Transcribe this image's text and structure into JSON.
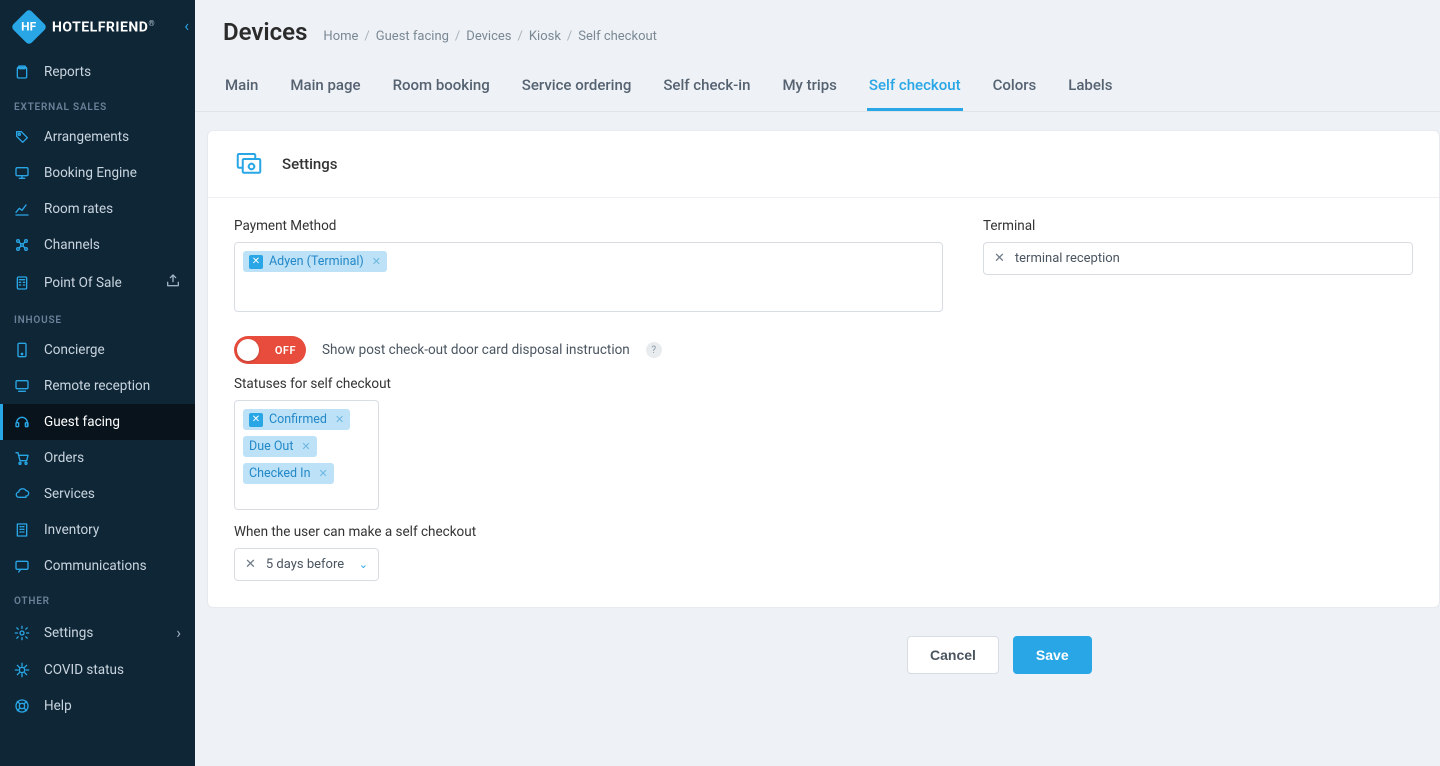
{
  "brand": {
    "name": "HOTELFRIEND",
    "logo_text": "HF"
  },
  "sidebar": {
    "top": [
      {
        "icon": "clipboard",
        "label": "Reports"
      }
    ],
    "sections": [
      {
        "title": "EXTERNAL SALES",
        "items": [
          {
            "icon": "tag",
            "label": "Arrangements"
          },
          {
            "icon": "monitor",
            "label": "Booking Engine"
          },
          {
            "icon": "chart",
            "label": "Room rates"
          },
          {
            "icon": "nodes",
            "label": "Channels"
          },
          {
            "icon": "calc",
            "label": "Point Of Sale",
            "trail": "share"
          }
        ]
      },
      {
        "title": "INHOUSE",
        "items": [
          {
            "icon": "phone",
            "label": "Concierge"
          },
          {
            "icon": "screen",
            "label": "Remote reception"
          },
          {
            "icon": "headset",
            "label": "Guest facing",
            "active": true
          },
          {
            "icon": "cart",
            "label": "Orders"
          },
          {
            "icon": "cloud",
            "label": "Services"
          },
          {
            "icon": "building",
            "label": "Inventory"
          },
          {
            "icon": "chat",
            "label": "Communications"
          }
        ]
      },
      {
        "title": "OTHER",
        "items": [
          {
            "icon": "gear",
            "label": "Settings",
            "trail": "chevron"
          },
          {
            "icon": "virus",
            "label": "COVID status"
          },
          {
            "icon": "lifebuoy",
            "label": "Help"
          }
        ]
      }
    ]
  },
  "page": {
    "title": "Devices",
    "breadcrumb": [
      "Home",
      "Guest facing",
      "Devices",
      "Kiosk",
      "Self checkout"
    ]
  },
  "tabs": [
    {
      "label": "Main"
    },
    {
      "label": "Main page"
    },
    {
      "label": "Room booking"
    },
    {
      "label": "Service ordering"
    },
    {
      "label": "Self check-in"
    },
    {
      "label": "My trips"
    },
    {
      "label": "Self checkout",
      "active": true
    },
    {
      "label": "Colors"
    },
    {
      "label": "Labels"
    }
  ],
  "settings": {
    "card_title": "Settings",
    "payment_method": {
      "label": "Payment Method",
      "tags": [
        {
          "label": "Adyen (Terminal)",
          "with_square": true
        }
      ]
    },
    "terminal": {
      "label": "Terminal",
      "value": "terminal reception"
    },
    "toggle": {
      "state": "OFF",
      "text": "Show post check-out door card disposal instruction"
    },
    "statuses": {
      "label": "Statuses for self checkout",
      "tags": [
        {
          "label": "Confirmed",
          "with_square": true
        },
        {
          "label": "Due Out",
          "with_square": false
        },
        {
          "label": "Checked In",
          "with_square": false
        }
      ]
    },
    "when": {
      "label": "When the user can make a self checkout",
      "value": "5 days before"
    }
  },
  "actions": {
    "cancel": "Cancel",
    "save": "Save"
  }
}
